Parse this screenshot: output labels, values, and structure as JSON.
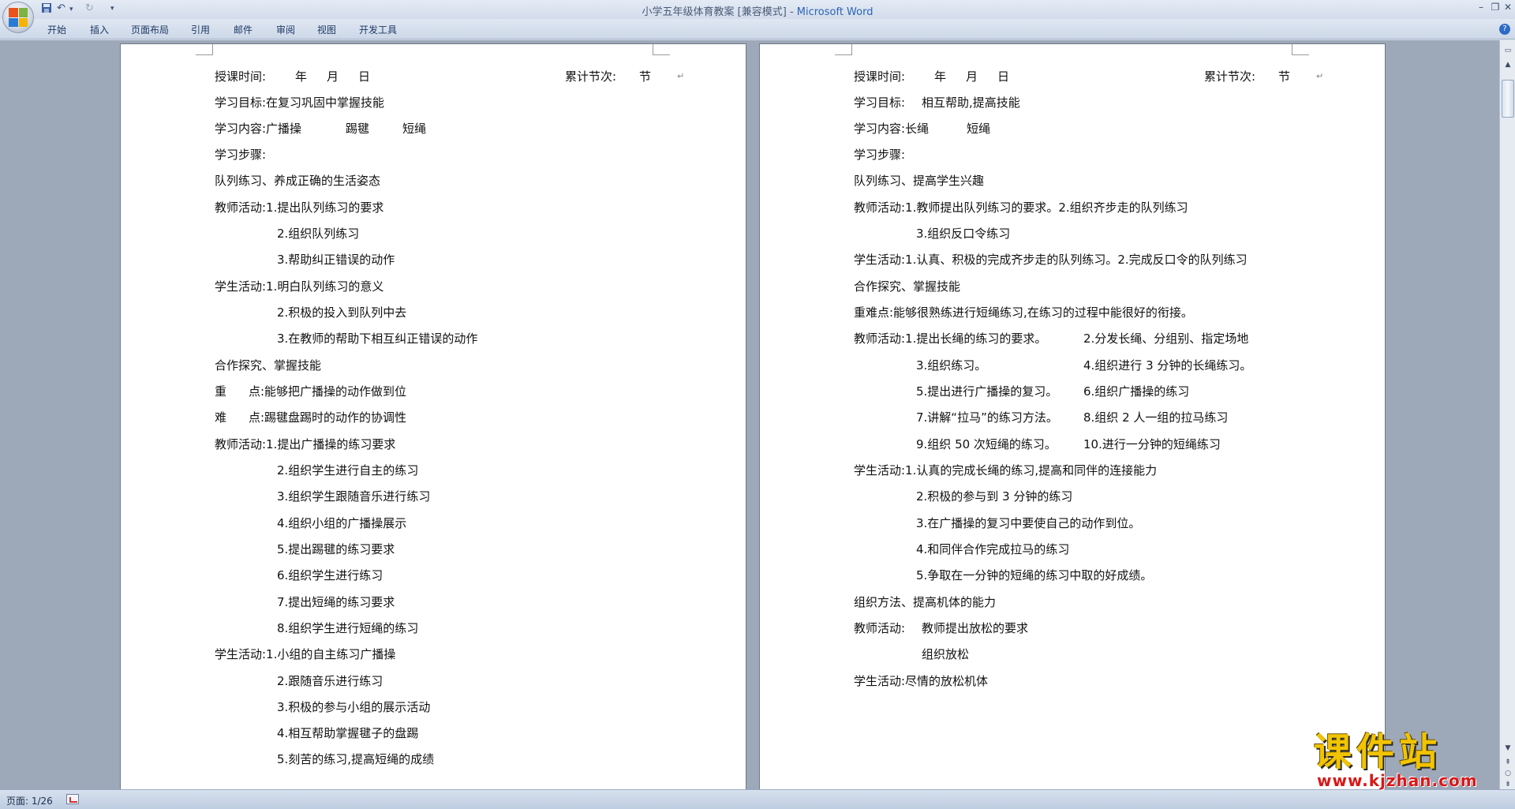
{
  "window": {
    "title": "小学五年级体育教案 [兼容模式]",
    "app_name": "Microsoft Word"
  },
  "quick_access": {
    "icons": [
      "save-icon",
      "undo-icon",
      "redo-icon",
      "customize-icon"
    ]
  },
  "ribbon": {
    "tabs": [
      "开始",
      "插入",
      "页面布局",
      "引用",
      "邮件",
      "审阅",
      "视图",
      "开发工具"
    ]
  },
  "status": {
    "page": "页面: 1/26"
  },
  "watermark": {
    "title": "课件站",
    "url": "www.kjzhan.com"
  },
  "left_page": {
    "lines": [
      "授课时间:",
      "年",
      "月",
      "日",
      "累计节次:",
      "节",
      "学习目标:在复习巩固中掌握技能",
      "学习内容:广播操",
      "踢毽",
      "短绳",
      "学习步骤:",
      "队列练习、养成正确的生活姿态",
      "教师活动:1.提出队列练习的要求",
      "2.组织队列练习",
      "3.帮助纠正错误的动作",
      "学生活动:1.明白队列练习的意义",
      "2.积极的投入到队列中去",
      "3.在教师的帮助下相互纠正错误的动作",
      "合作探究、掌握技能",
      "重",
      "点:能够把广播操的动作做到位",
      "难",
      "点:踢毽盘踢时的动作的协调性",
      "教师活动:1.提出广播操的练习要求",
      "2.组织学生进行自主的练习",
      "3.组织学生跟随音乐进行练习",
      "4.组织小组的广播操展示",
      "5.提出踢毽的练习要求",
      "6.组织学生进行练习",
      "7.提出短绳的练习要求",
      "8.组织学生进行短绳的练习",
      "学生活动:1.小组的自主练习广播操",
      "2.跟随音乐进行练习",
      "3.积极的参与小组的展示活动",
      "4.相互帮助掌握毽子的盘踢",
      "5.刻苦的练习,提高短绳的成绩"
    ]
  },
  "right_page": {
    "lines": [
      "授课时间:",
      "年",
      "月",
      "日",
      "累计节次:",
      "节",
      "学习目标:",
      "相互帮助,提高技能",
      "学习内容:长绳",
      "短绳",
      "学习步骤:",
      "队列练习、提高学生兴趣",
      "教师活动:1.教师提出队列练习的要求。2.组织齐步走的队列练习",
      "3.组织反口令练习",
      "学生活动:1.认真、积极的完成齐步走的队列练习。2.完成反口令的队列练习",
      "合作探究、掌握技能",
      "重难点:能够很熟练进行短绳练习,在练习的过程中能很好的衔接。",
      "教师活动:1.提出长绳的练习的要求。",
      "2.分发长绳、分组别、指定场地",
      "3.组织练习。",
      "4.组织进行 3 分钟的长绳练习。",
      "5.提出进行广播操的复习。",
      "6.组织广播操的练习",
      "7.讲解“拉马”的练习方法。",
      "8.组织 2 人一组的拉马练习",
      "9.组织 50 次短绳的练习。",
      "10.进行一分钟的短绳练习",
      "学生活动:1.认真的完成长绳的练习,提高和同伴的连接能力",
      "2.积极的参与到 3 分钟的练习",
      "3.在广播操的复习中要使自己的动作到位。",
      "4.和同伴合作完成拉马的练习",
      "5.争取在一分钟的短绳的练习中取的好成绩。",
      "组织方法、提高机体的能力",
      "教师活动:",
      "教师提出放松的要求",
      "组织放松",
      "学生活动:尽情的放松机体"
    ]
  }
}
